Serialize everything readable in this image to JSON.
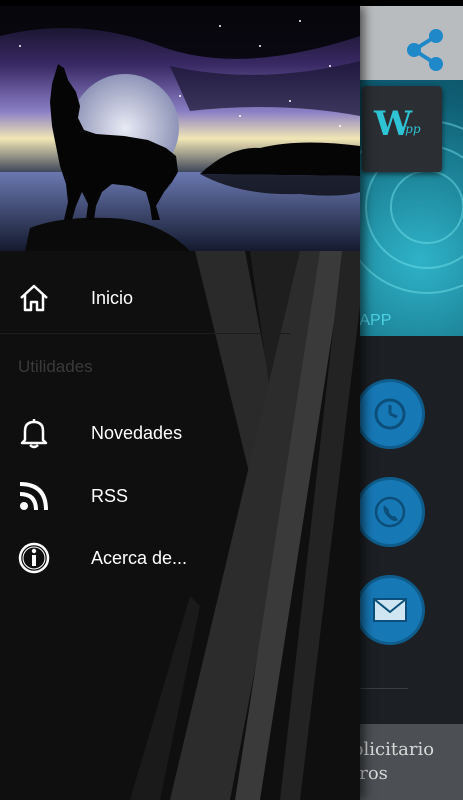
{
  "background_app": {
    "banner_caption": "s tu APP",
    "logo_text": "W",
    "logo_sub": "app",
    "ad_line1": "blicitario",
    "ad_line2": "tros",
    "icons": [
      "share-icon",
      "clock-icon",
      "phone-icon",
      "mail-icon"
    ],
    "colors": {
      "toolbar": "#b9bcbe",
      "accent": "#1778b6",
      "banner": "#0f5f74"
    }
  },
  "drawer": {
    "header_image": "howling-wolf-moon-night-lake",
    "items": [
      {
        "label": "Inicio",
        "icon": "home-icon"
      },
      {
        "label": "Novedades",
        "icon": "bell-icon"
      },
      {
        "label": "RSS",
        "icon": "rss-icon"
      },
      {
        "label": "Acerca de...",
        "icon": "info-icon"
      }
    ],
    "section_label": "Utilidades"
  }
}
